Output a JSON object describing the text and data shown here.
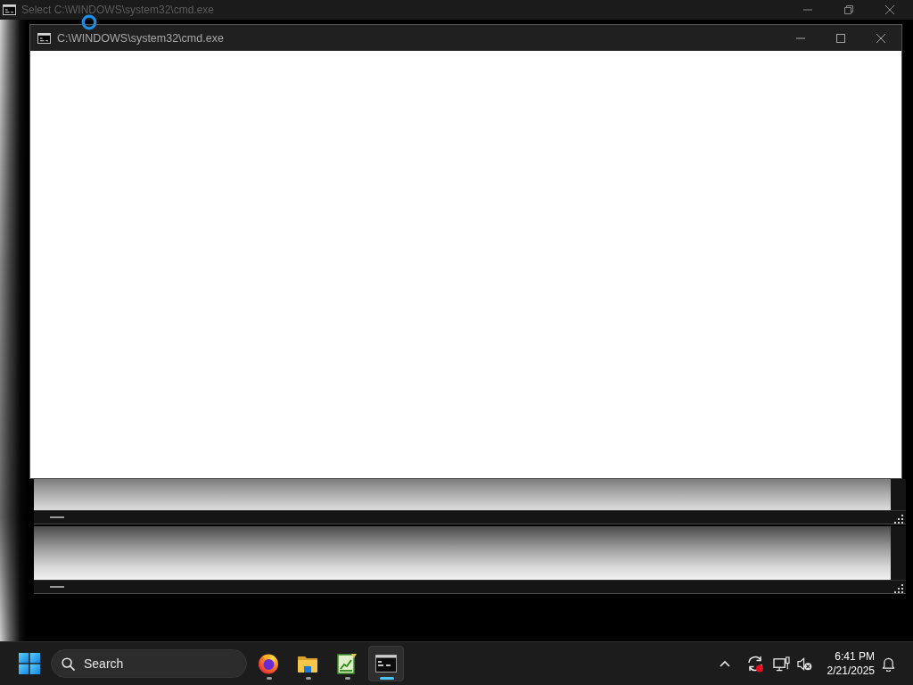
{
  "background_window": {
    "title": "Select C:\\WINDOWS\\system32\\cmd.exe",
    "active": false
  },
  "window": {
    "title": "C:\\WINDOWS\\system32\\cmd.exe",
    "active": true
  },
  "taskbar": {
    "search": {
      "placeholder": "Search"
    },
    "apps": [
      {
        "kind": "browser",
        "selected": false
      },
      {
        "kind": "folder",
        "selected": false
      },
      {
        "kind": "notepad",
        "selected": false
      },
      {
        "kind": "terminal",
        "selected": true
      }
    ],
    "tray": [
      {
        "kind": "chevron"
      },
      {
        "kind": "sync"
      },
      {
        "kind": "monitor"
      },
      {
        "kind": "speaker"
      }
    ],
    "clock": {
      "time": "6:41 PM",
      "date": "2/21/2025"
    }
  }
}
